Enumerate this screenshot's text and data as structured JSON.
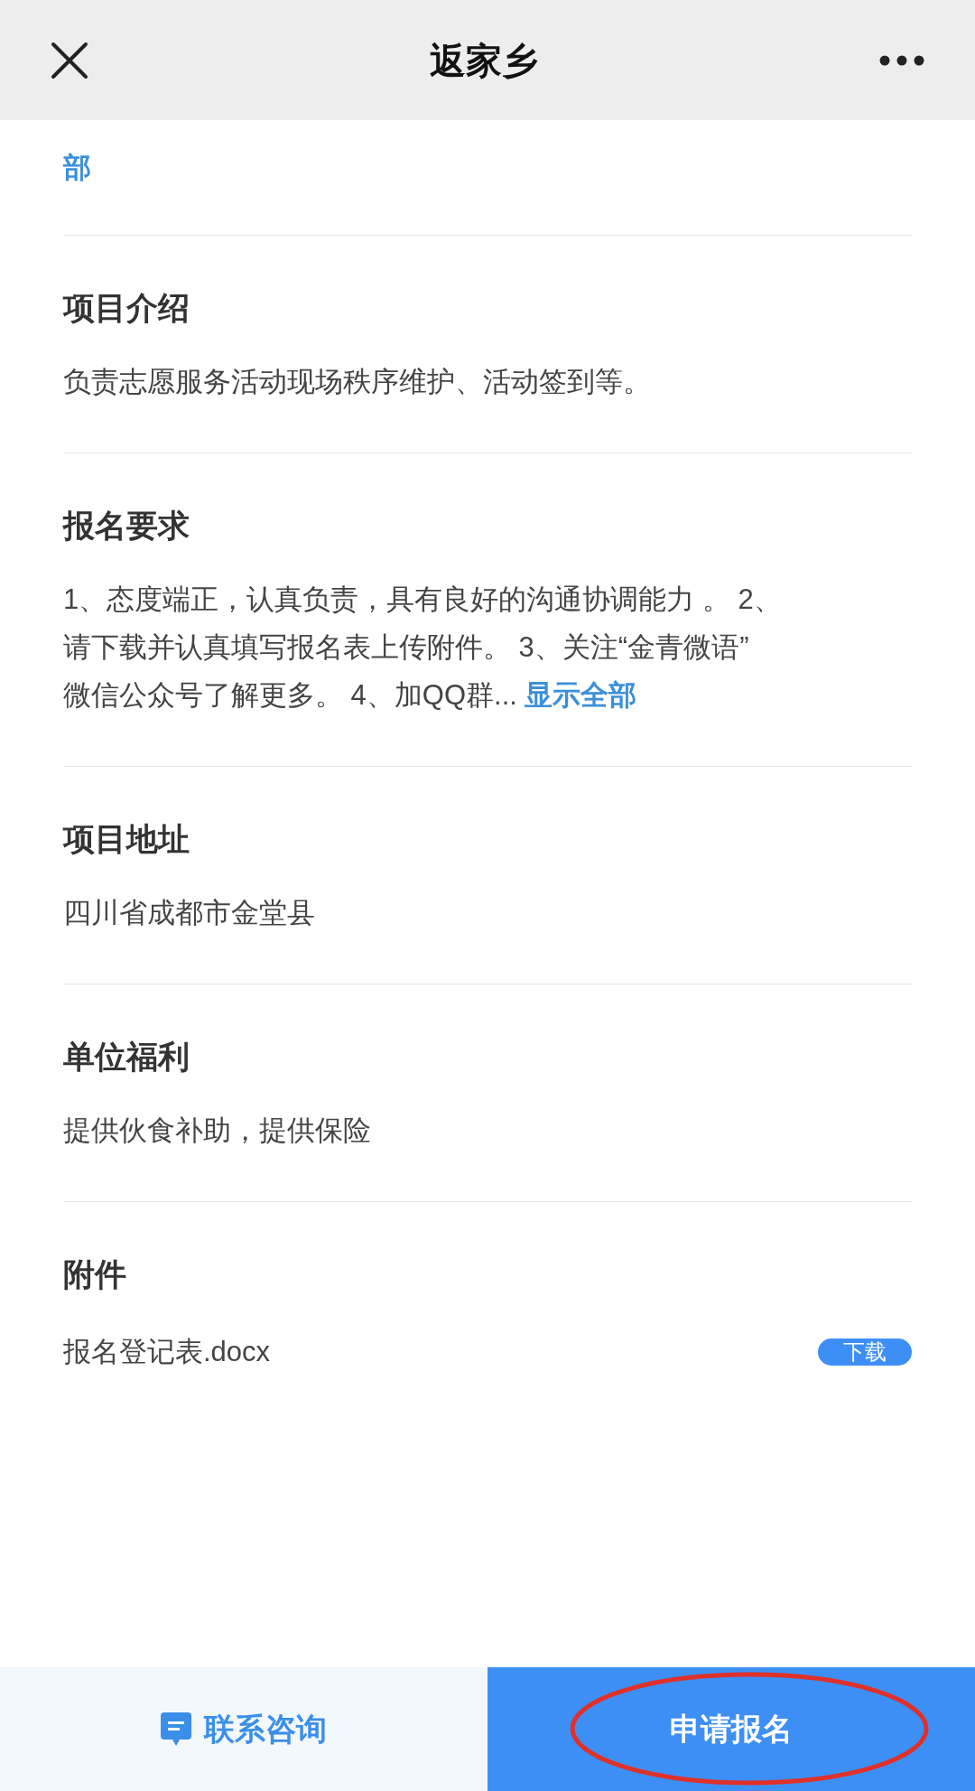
{
  "header": {
    "title": "返家乡"
  },
  "intro_tail": {
    "link": "部"
  },
  "sections": [
    {
      "title": "项目介绍",
      "lines": [
        "负责志愿服务活动现场秩序维护、活动签到等。"
      ]
    },
    {
      "title": "报名要求",
      "lines": [
        "1、态度端正，认真负责，具有良好的沟通协调能力 。 2、",
        "请下载并认真填写报名表上传附件。 3、关注“金青微语”",
        "微信公众号了解更多。 4、加QQ群..."
      ],
      "more": "显示全部"
    },
    {
      "title": "项目地址",
      "lines": [
        "四川省成都市金堂县"
      ]
    },
    {
      "title": "单位福利",
      "lines": [
        "提供伙食补助，提供保险"
      ]
    }
  ],
  "attachments": {
    "title": "附件",
    "files": [
      {
        "name": "报名登记表.docx",
        "action": "下载"
      }
    ]
  },
  "bottom_bar": {
    "consult": "联系咨询",
    "apply": "申请报名",
    "apply_circled": true
  }
}
